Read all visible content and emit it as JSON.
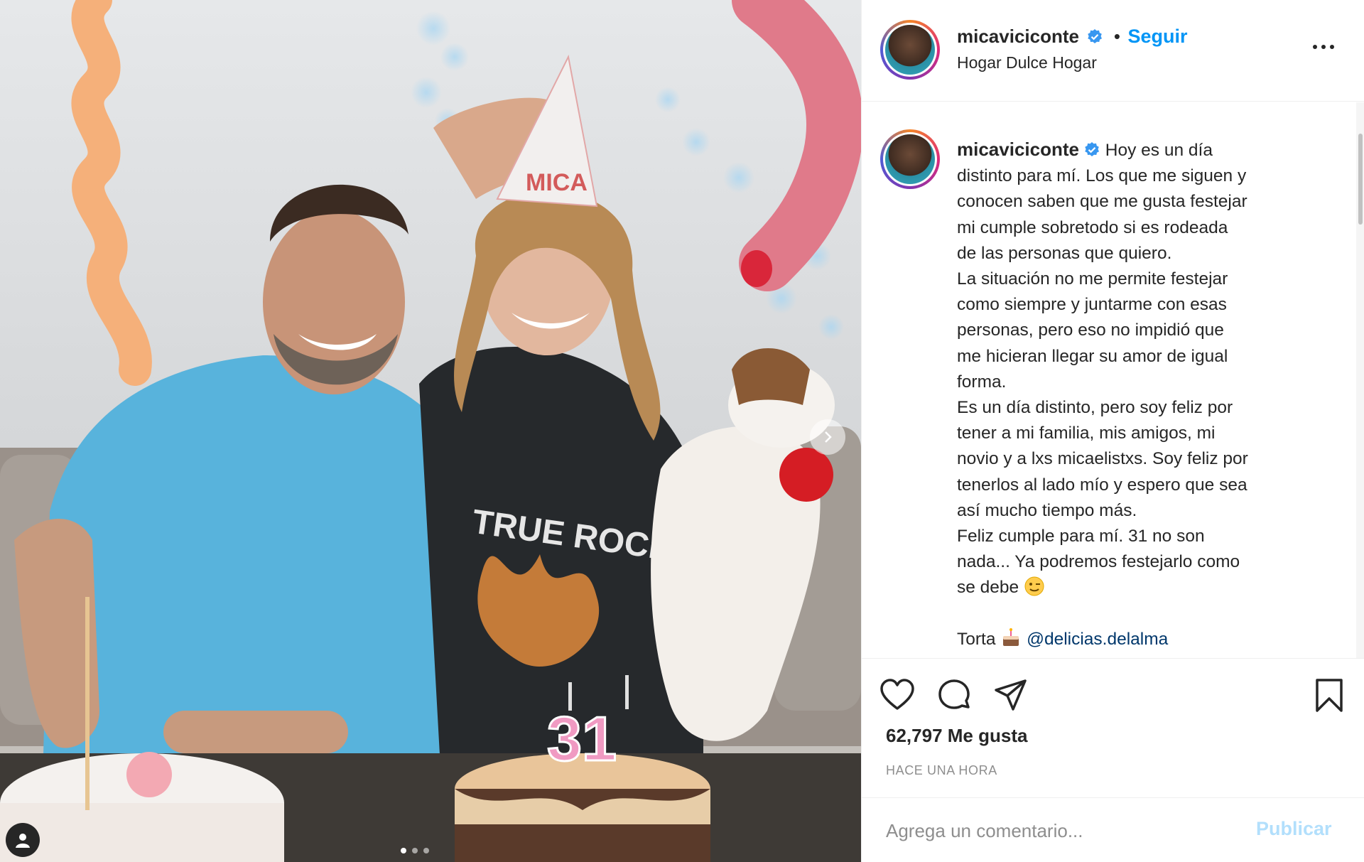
{
  "post": {
    "username": "micaviciconte",
    "follow_label": "Seguir",
    "location": "Hogar Dulce Hogar",
    "separator": "•",
    "caption_lines": [
      "Hoy es un día",
      "distinto para mí. Los que me siguen y",
      "conocen saben que me gusta festejar",
      "mi cumple sobretodo si es rodeada",
      "de las personas que quiero.",
      "La situación no me permite festejar",
      "como siempre y juntarme con esas",
      "personas, pero eso no impidió que",
      "me hicieran llegar su amor de igual",
      "forma.",
      "Es un día distinto, pero soy feliz por",
      "tener a mi familia, mis amigos, mi",
      "novio y a lxs micaelistxs. Soy feliz por",
      "tenerlos al lado mío y espero que sea",
      "así mucho tiempo más.",
      "Feliz cumple para mí. 31 no son",
      "nada... Ya podremos festejarlo como",
      "se debe"
    ],
    "cake_prefix": "Torta",
    "cake_mention": "@delicias.delalma",
    "likes": "62,797 Me gusta",
    "time": "HACE UNA HORA",
    "comment_placeholder": "Agrega un comentario...",
    "publish_label": "Publicar"
  },
  "photo": {
    "candle_text": "31",
    "hat_text": "MICA",
    "shirt_text": "TRUE ROCK",
    "carousel_total": 3,
    "carousel_active": 1
  },
  "icons": {
    "verified": "verified-badge-icon",
    "more": "more-options-icon",
    "like": "heart-icon",
    "comment": "comment-icon",
    "share": "paper-plane-icon",
    "save": "bookmark-icon",
    "next": "chevron-right-icon",
    "tag": "user-tag-icon",
    "wink": "wink-emoji-icon",
    "cake": "cake-emoji-icon"
  },
  "colors": {
    "follow": "#0095f6",
    "publish_disabled": "#b2dffc",
    "text": "#262626",
    "muted": "#8e8e8e",
    "mention": "#00376b"
  }
}
